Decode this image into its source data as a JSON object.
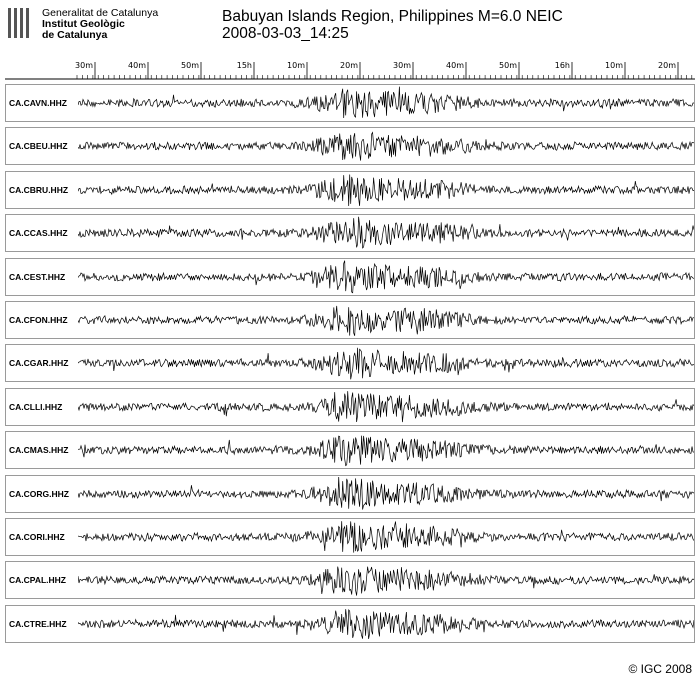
{
  "logo": {
    "line1": "Generalitat de Catalunya",
    "line2": "Institut Geològic",
    "line3": "de Catalunya",
    "icon": "catalan-stripes-shield"
  },
  "title": {
    "line1": "Babuyan Islands Region, Philippines M=6.0 NEIC",
    "line2": "2008-03-03_14:25"
  },
  "copyright": "© IGC 2008",
  "chart_data": {
    "type": "line",
    "description_type": "seismogram-record-section",
    "time_axis": {
      "tick_labels": [
        "30m",
        "40m",
        "50m",
        "15h",
        "10m",
        "20m",
        "30m",
        "40m",
        "50m",
        "16h",
        "10m",
        "20m"
      ],
      "major_interval_minutes": 10
    },
    "series": [
      {
        "name": "CA.CAVN.HHZ"
      },
      {
        "name": "CA.CBEU.HHZ"
      },
      {
        "name": "CA.CBRU.HHZ"
      },
      {
        "name": "CA.CCAS.HHZ"
      },
      {
        "name": "CA.CEST.HHZ"
      },
      {
        "name": "CA.CFON.HHZ"
      },
      {
        "name": "CA.CGAR.HHZ"
      },
      {
        "name": "CA.CLLI.HHZ"
      },
      {
        "name": "CA.CMAS.HHZ"
      },
      {
        "name": "CA.CORG.HHZ"
      },
      {
        "name": "CA.CORI.HHZ"
      },
      {
        "name": "CA.CPAL.HHZ"
      },
      {
        "name": "CA.CTRE.HHZ"
      }
    ],
    "grid": false,
    "colors": {
      "trace": "#000000",
      "frame": "#9a9a9a"
    }
  }
}
